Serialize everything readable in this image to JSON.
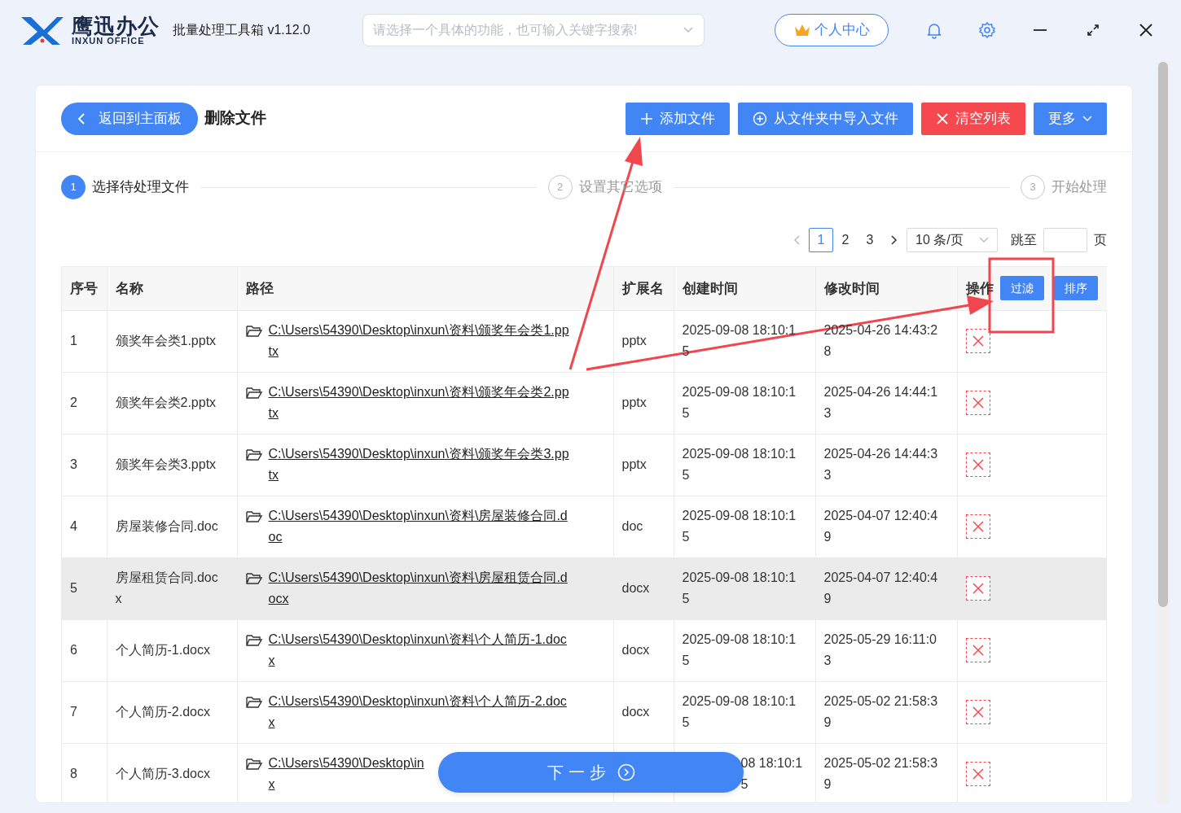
{
  "app": {
    "logo_cn": "鹰迅办公",
    "logo_en": "INXUN OFFICE",
    "title": "批量处理工具箱 v1.12.0",
    "search_placeholder": "请选择一个具体的功能，也可输入关键字搜索!",
    "user_button": "个人中心"
  },
  "page": {
    "back_button": "返回到主面板",
    "title": "删除文件",
    "actions": [
      {
        "label": "添加文件",
        "kind": "add"
      },
      {
        "label": "从文件夹中导入文件",
        "kind": "import"
      },
      {
        "label": "清空列表",
        "kind": "clear"
      },
      {
        "label": "更多",
        "kind": "more"
      }
    ]
  },
  "steps": [
    {
      "number": "1",
      "label": "选择待处理文件",
      "selected": true
    },
    {
      "number": "2",
      "label": "设置其它选项",
      "selected": false
    },
    {
      "number": "3",
      "label": "开始处理",
      "selected": false
    }
  ],
  "pagination": {
    "pages": [
      {
        "label": "1",
        "selected": true
      },
      {
        "label": "2",
        "selected": false
      },
      {
        "label": "3",
        "selected": false
      }
    ],
    "page_size": "10 条/页",
    "jump_label": "跳至",
    "page_label": "页"
  },
  "table": {
    "columns": [
      "序号",
      "名称",
      "路径",
      "扩展名",
      "创建时间",
      "修改时间",
      "操作"
    ],
    "filter_button": "过滤",
    "sort_button": "排序",
    "rows": [
      {
        "index": "1",
        "name": [
          "颁奖年会类1.pptx"
        ],
        "path": [
          "C:\\Users\\54390\\Desktop\\inxun\\资料\\颁奖年会类1.pp",
          "tx"
        ],
        "ext": "pptx",
        "created": [
          "2025-09-08 18:10:1",
          "5"
        ],
        "modified": [
          "2025-04-26 14:43:2",
          "8"
        ],
        "selected": false
      },
      {
        "index": "2",
        "name": [
          "颁奖年会类2.pptx"
        ],
        "path": [
          "C:\\Users\\54390\\Desktop\\inxun\\资料\\颁奖年会类2.pp",
          "tx"
        ],
        "ext": "pptx",
        "created": [
          "2025-09-08 18:10:1",
          "5"
        ],
        "modified": [
          "2025-04-26 14:44:1",
          "3"
        ],
        "selected": false
      },
      {
        "index": "3",
        "name": [
          "颁奖年会类3.pptx"
        ],
        "path": [
          "C:\\Users\\54390\\Desktop\\inxun\\资料\\颁奖年会类3.pp",
          "tx"
        ],
        "ext": "pptx",
        "created": [
          "2025-09-08 18:10:1",
          "5"
        ],
        "modified": [
          "2025-04-26 14:44:3",
          "3"
        ],
        "selected": false
      },
      {
        "index": "4",
        "name": [
          "房屋装修合同.doc"
        ],
        "path": [
          "C:\\Users\\54390\\Desktop\\inxun\\资料\\房屋装修合同.d",
          "oc"
        ],
        "ext": "doc",
        "created": [
          "2025-09-08 18:10:1",
          "5"
        ],
        "modified": [
          "2025-04-07 12:40:4",
          "9"
        ],
        "selected": false
      },
      {
        "index": "5",
        "name": [
          "房屋租赁合同.doc",
          "x"
        ],
        "path": [
          "C:\\Users\\54390\\Desktop\\inxun\\资料\\房屋租赁合同.d",
          "ocx"
        ],
        "ext": "docx",
        "created": [
          "2025-09-08 18:10:1",
          "5"
        ],
        "modified": [
          "2025-04-07 12:40:4",
          "9"
        ],
        "selected": true
      },
      {
        "index": "6",
        "name": [
          "个人简历-1.docx"
        ],
        "path": [
          "C:\\Users\\54390\\Desktop\\inxun\\资料\\个人简历-1.doc",
          "x"
        ],
        "ext": "docx",
        "created": [
          "2025-09-08 18:10:1",
          "5"
        ],
        "modified": [
          "2025-05-29 16:11:0",
          "3"
        ],
        "selected": false
      },
      {
        "index": "7",
        "name": [
          "个人简历-2.docx"
        ],
        "path": [
          "C:\\Users\\54390\\Desktop\\inxun\\资料\\个人简历-2.doc",
          "x"
        ],
        "ext": "docx",
        "created": [
          "2025-09-08 18:10:1",
          "5"
        ],
        "modified": [
          "2025-05-02 21:58:3",
          "9"
        ],
        "selected": false
      },
      {
        "index": "8",
        "name": [
          "个人简历-3.docx"
        ],
        "path": [
          "C:\\Users\\54390\\Desktop\\in",
          "x"
        ],
        "ext": "",
        "created": [
          "08 18:10:1",
          "5"
        ],
        "modified": [
          "2025-05-02 21:58:3",
          "9"
        ],
        "selected": false
      }
    ]
  },
  "next_button": "下一步"
}
